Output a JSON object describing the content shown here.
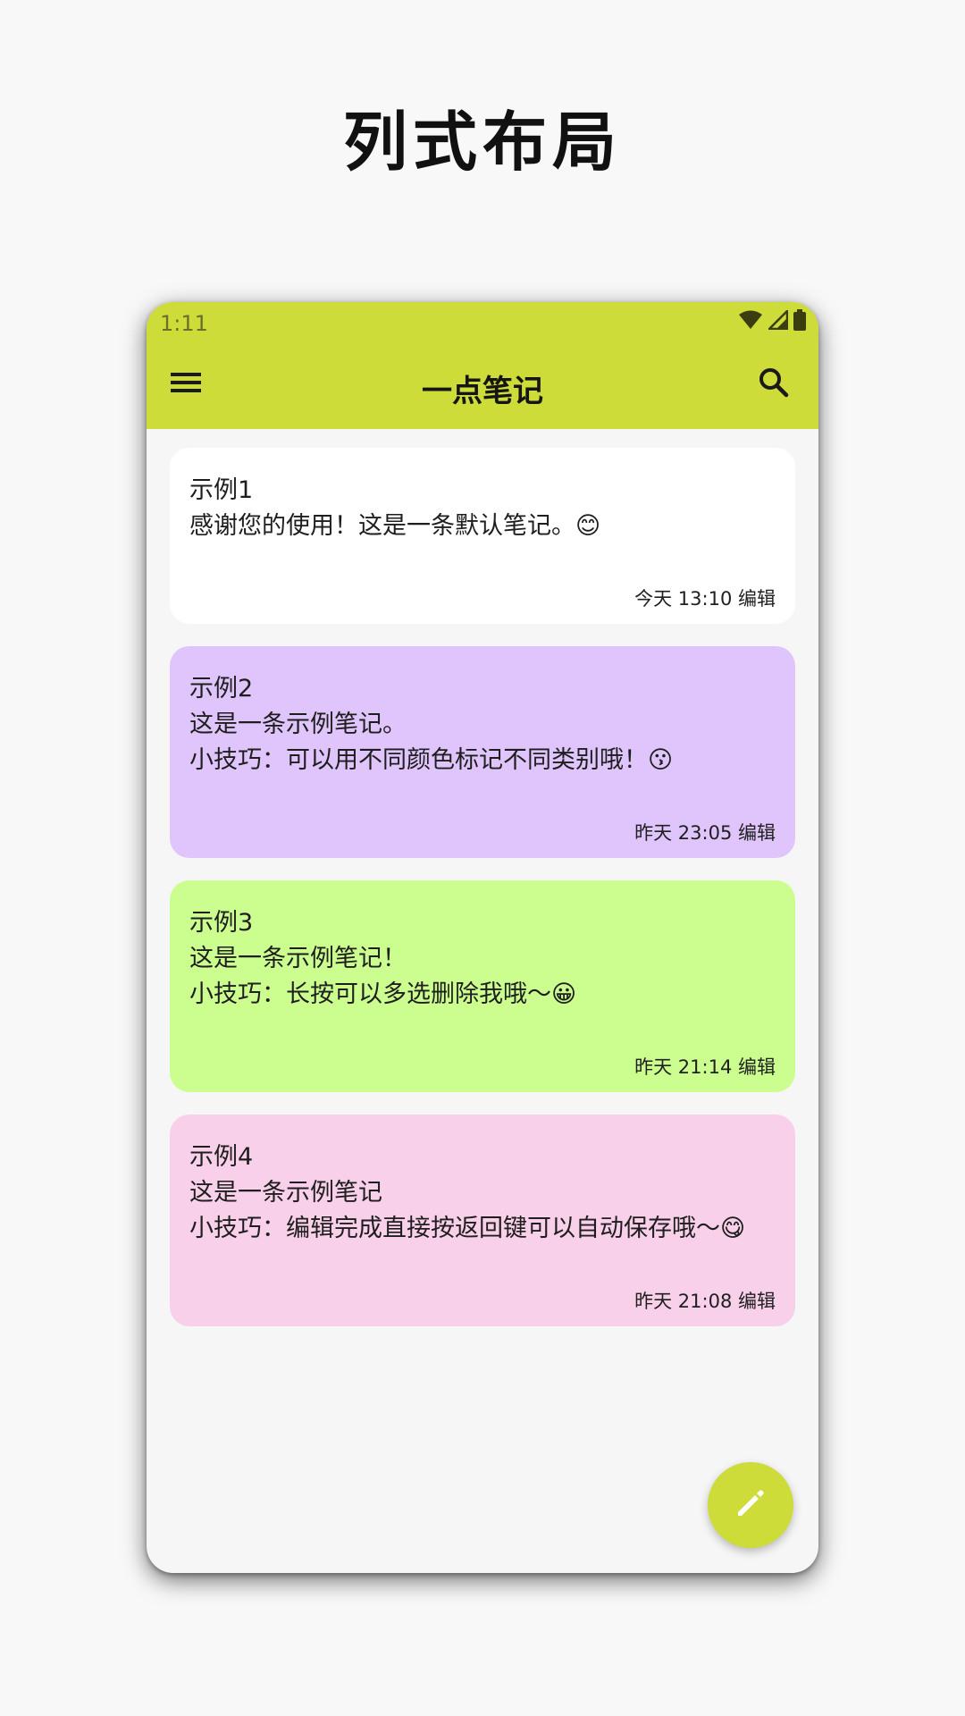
{
  "promo": {
    "heading": "列式布局"
  },
  "status_bar": {
    "time": "1:11",
    "icons": [
      "wifi-icon",
      "signal-icon",
      "battery-icon"
    ]
  },
  "app_bar": {
    "title": "一点笔记",
    "menu_icon": "menu-icon",
    "search_icon": "search-icon",
    "color": "#cddc39"
  },
  "notes": [
    {
      "title": "示例1",
      "lines": [
        "感谢您的使用！这是一条默认笔记。😊"
      ],
      "edited": "今天 13:10 编辑",
      "color": "#ffffff"
    },
    {
      "title": "示例2",
      "lines": [
        "这是一条示例笔记。",
        "小技巧：可以用不同颜色标记不同类别哦！😗"
      ],
      "edited": "昨天 23:05 编辑",
      "color": "#dfc5fb"
    },
    {
      "title": "示例3",
      "lines": [
        "这是一条示例笔记！",
        "小技巧：长按可以多选删除我哦～😀"
      ],
      "edited": "昨天 21:14 编辑",
      "color": "#ccfe8f"
    },
    {
      "title": "示例4",
      "lines": [
        "这是一条示例笔记",
        "小技巧：编辑完成直接按返回键可以自动保存哦～😋"
      ],
      "edited": "昨天 21:08 编辑",
      "color": "#f9d0ea"
    }
  ],
  "fab": {
    "icon": "pencil-icon",
    "color": "#cddc39"
  }
}
